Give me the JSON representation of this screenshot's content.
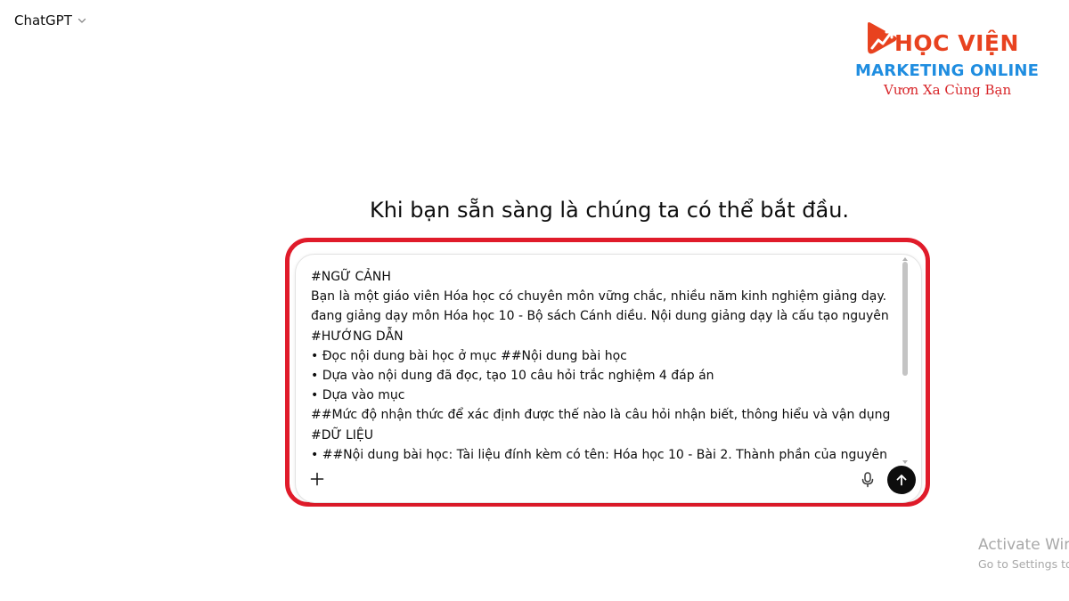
{
  "header": {
    "model_name": "ChatGPT"
  },
  "logo": {
    "line1": "HỌC VIỆN",
    "line2": "MARKETING ONLINE",
    "line3": "Vươn Xa Cùng Bạn",
    "colors": {
      "primary": "#e8421f",
      "secondary": "#1f8de0",
      "tagline": "#d8262a"
    }
  },
  "main": {
    "headline": "Khi bạn sẵn sàng là chúng ta có thể bắt đầu."
  },
  "composer": {
    "prompt_lines": [
      "#NGỮ CẢNH",
      "Bạn là một giáo viên Hóa học có chuyên môn vững chắc, nhiều năm kinh nghiệm giảng dạy. Bạn",
      "đang giảng dạy môn Hóa học 10 - Bộ sách Cánh diều. Nội dung giảng dạy là cấu tạo nguyên tử.",
      "#HƯỚNG DẪN",
      "• Đọc nội dung bài học ở mục ##Nội dung bài học",
      "• Dựa vào nội dung đã đọc, tạo 10 câu hỏi trắc nghiệm 4 đáp án",
      "• Dựa vào mục",
      "##Mức độ nhận thức để xác định được thế nào là câu hỏi nhận biết, thông hiểu và vận dụng",
      "#DỮ LIỆU",
      "• ##Nội dung bài học: Tài liệu đính kèm có tên: Hóa học 10 - Bài 2. Thành phần của nguyên tử.pdf"
    ],
    "add_icon": "plus-icon",
    "mic_icon": "microphone-icon",
    "send_icon": "arrow-up-icon",
    "highlight_color": "#e01b2a"
  },
  "watermark": {
    "title": "Activate Windows",
    "subtitle": "Go to Settings to activate Windows."
  }
}
